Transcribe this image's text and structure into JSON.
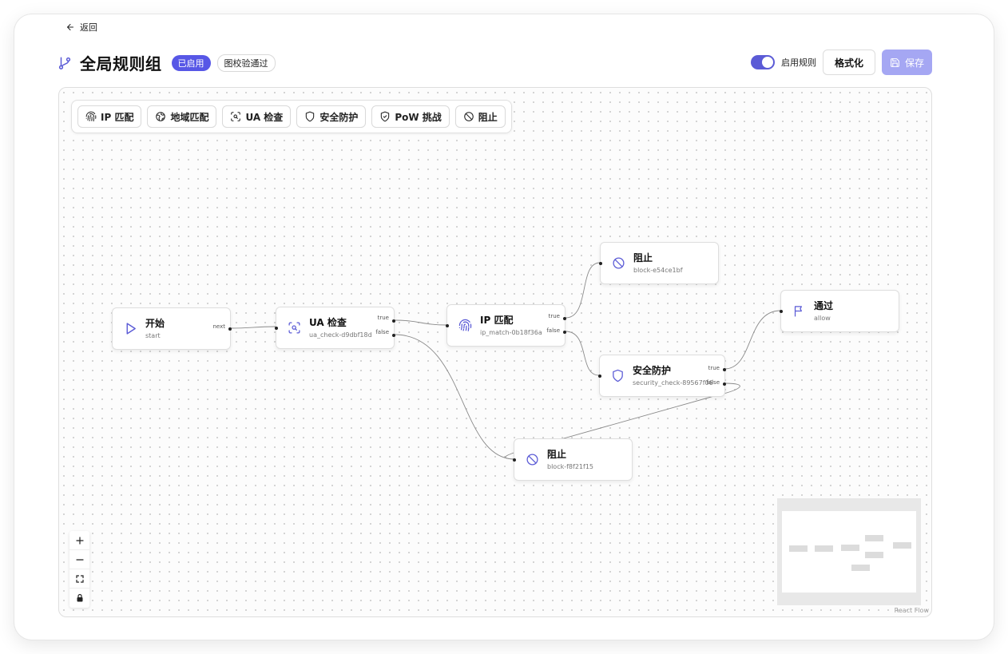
{
  "nav": {
    "back_label": "返回"
  },
  "header": {
    "title": "全局规则组",
    "badge_enabled": "已启用",
    "badge_validation": "图校验通过"
  },
  "actions": {
    "toggle_label": "启用规则",
    "format_label": "格式化",
    "save_label": "保存",
    "toggle_on": true
  },
  "palette": [
    {
      "label": "IP 匹配",
      "icon": "fingerprint-icon"
    },
    {
      "label": "地域匹配",
      "icon": "globe-icon"
    },
    {
      "label": "UA 检查",
      "icon": "scan-icon"
    },
    {
      "label": "安全防护",
      "icon": "shield-icon"
    },
    {
      "label": "PoW 挑战",
      "icon": "shield-check-icon"
    },
    {
      "label": "阻止",
      "icon": "ban-icon"
    }
  ],
  "nodes": {
    "start": {
      "label": "开始",
      "id": "start",
      "port": "next",
      "icon": "play-icon"
    },
    "ua": {
      "label": "UA 检查",
      "id": "ua_check-d9dbf18d",
      "port_true": "true",
      "port_false": "false",
      "icon": "scan-icon"
    },
    "ip": {
      "label": "IP 匹配",
      "id": "ip_match-0b18f36a",
      "port_true": "true",
      "port_false": "false",
      "icon": "fingerprint-icon"
    },
    "block1": {
      "label": "阻止",
      "id": "block-e54ce1bf",
      "icon": "ban-icon"
    },
    "security": {
      "label": "安全防护",
      "id": "security_check-89567f06",
      "port_true": "true",
      "port_false": "false",
      "icon": "shield-icon"
    },
    "allow": {
      "label": "通过",
      "id": "allow",
      "icon": "flag-icon"
    },
    "block2": {
      "label": "阻止",
      "id": "block-f8f21f15",
      "icon": "ban-icon"
    }
  },
  "flow_attribution": "React Flow",
  "colors": {
    "accent": "#5b5bd6",
    "badge": "#5757e6",
    "save_disabled": "#a5a7f3"
  }
}
